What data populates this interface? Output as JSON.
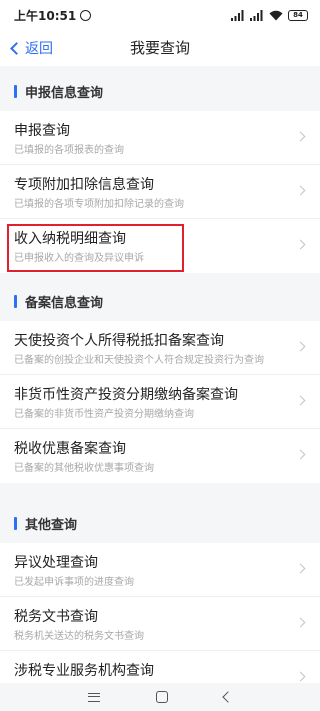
{
  "status": {
    "time": "上午10:51",
    "battery": "84"
  },
  "nav": {
    "back_label": "返回",
    "title": "我要查询"
  },
  "sections": [
    {
      "title": "申报信息查询",
      "items": [
        {
          "title": "申报查询",
          "subtitle": "已填报的各项报表的查询"
        },
        {
          "title": "专项附加扣除信息查询",
          "subtitle": "已填报的各项专项附加扣除记录的查询"
        },
        {
          "title": "收入纳税明细查询",
          "subtitle": "已申报收入的查询及异议申诉"
        }
      ]
    },
    {
      "title": "备案信息查询",
      "items": [
        {
          "title": "天使投资个人所得税抵扣备案查询",
          "subtitle": "已备案的创投企业和天使投资个人符合规定投资行为查询"
        },
        {
          "title": "非货币性资产投资分期缴纳备案查询",
          "subtitle": "已备案的非货币性资产投资分期缴纳查询"
        },
        {
          "title": "税收优惠备案查询",
          "subtitle": "已备案的其他税收优惠事项查询"
        }
      ]
    },
    {
      "title": "其他查询",
      "items": [
        {
          "title": "异议处理查询",
          "subtitle": "已发起申诉事项的进度查询"
        },
        {
          "title": "税务文书查询",
          "subtitle": "税务机关送达的税务文书查询"
        },
        {
          "title": "涉税专业服务机构查询",
          "subtitle": ""
        }
      ]
    }
  ]
}
